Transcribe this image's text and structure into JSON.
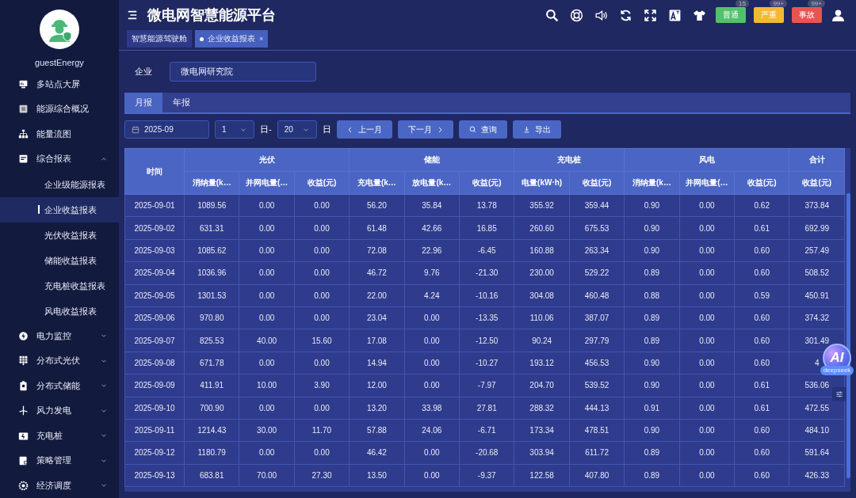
{
  "user": {
    "name": "guestEnergy"
  },
  "sidebar": {
    "items": [
      {
        "label": "多站点大屏"
      },
      {
        "label": "能源综合概况"
      },
      {
        "label": "能量流图"
      },
      {
        "label": "综合报表",
        "expanded": true,
        "children": [
          {
            "label": "企业级能源报表",
            "selected": false
          },
          {
            "label": "企业收益报表",
            "selected": true
          },
          {
            "label": "光伏收益报表",
            "selected": false
          },
          {
            "label": "储能收益报表",
            "selected": false
          },
          {
            "label": "充电桩收益报表",
            "selected": false
          },
          {
            "label": "风电收益报表",
            "selected": false
          }
        ]
      },
      {
        "label": "电力监控",
        "expanded": false
      },
      {
        "label": "分布式光伏",
        "expanded": false
      },
      {
        "label": "分布式储能",
        "expanded": false
      },
      {
        "label": "风力发电",
        "expanded": false
      },
      {
        "label": "充电桩",
        "expanded": false
      },
      {
        "label": "策略管理",
        "expanded": false
      },
      {
        "label": "经济调度",
        "expanded": false
      }
    ]
  },
  "header": {
    "title": "微电网智慧能源平台",
    "alerts": [
      {
        "label": "普通",
        "count": "15",
        "color": "#52c26a"
      },
      {
        "label": "严重",
        "count": "99+",
        "color": "#f4b832"
      },
      {
        "label": "事故",
        "count": "99+",
        "color": "#e9544f"
      }
    ]
  },
  "page_tabs": [
    {
      "label": "智慧能源驾驶舱",
      "selected": false
    },
    {
      "label": "企业收益报表",
      "selected": true,
      "close": "×"
    }
  ],
  "filter": {
    "label": "企业",
    "value": "微电网研究院"
  },
  "report_tabs": [
    {
      "label": "月报",
      "selected": true
    },
    {
      "label": "年报",
      "selected": false
    }
  ],
  "controls": {
    "month": "2025-09",
    "day_from": "1",
    "day_from_suffix": "日-",
    "day_to": "20",
    "day_to_suffix": "日",
    "prev": "上一月",
    "next": "下一月",
    "query": "查询",
    "export": "导出"
  },
  "table": {
    "groups": [
      {
        "label": "时间"
      },
      {
        "label": "光伏",
        "columns": [
          "消纳量(k…",
          "并网电量(…",
          "收益(元)"
        ]
      },
      {
        "label": "储能",
        "columns": [
          "充电量(k…",
          "放电量(k…",
          "收益(元)"
        ]
      },
      {
        "label": "充电桩",
        "columns": [
          "电量(kW·h)",
          "收益(元)"
        ]
      },
      {
        "label": "风电",
        "columns": [
          "消纳量(k…",
          "并网电量(…",
          "收益(元)"
        ]
      },
      {
        "label": "合计",
        "columns": [
          "收益(元)"
        ]
      }
    ],
    "rows": [
      [
        "2025-09-01",
        "1089.56",
        "0.00",
        "0.00",
        "56.20",
        "35.84",
        "13.78",
        "355.92",
        "359.44",
        "0.90",
        "0.00",
        "0.62",
        "373.84"
      ],
      [
        "2025-09-02",
        "631.31",
        "0.00",
        "0.00",
        "61.48",
        "42.66",
        "16.85",
        "260.60",
        "675.53",
        "0.90",
        "0.00",
        "0.61",
        "692.99"
      ],
      [
        "2025-09-03",
        "1085.62",
        "0.00",
        "0.00",
        "72.08",
        "22.96",
        "-6.45",
        "160.88",
        "263.34",
        "0.90",
        "0.00",
        "0.60",
        "257.49"
      ],
      [
        "2025-09-04",
        "1036.96",
        "0.00",
        "0.00",
        "46.72",
        "9.76",
        "-21.30",
        "230.00",
        "529.22",
        "0.89",
        "0.00",
        "0.60",
        "508.52"
      ],
      [
        "2025-09-05",
        "1301.53",
        "0.00",
        "0.00",
        "22.00",
        "4.24",
        "-10.16",
        "304.08",
        "460.48",
        "0.88",
        "0.00",
        "0.59",
        "450.91"
      ],
      [
        "2025-09-06",
        "970.80",
        "0.00",
        "0.00",
        "23.04",
        "0.00",
        "-13.35",
        "110.06",
        "387.07",
        "0.89",
        "0.00",
        "0.60",
        "374.32"
      ],
      [
        "2025-09-07",
        "825.53",
        "40.00",
        "15.60",
        "17.08",
        "0.00",
        "-12.50",
        "90.24",
        "297.79",
        "0.89",
        "0.00",
        "0.60",
        "301.49"
      ],
      [
        "2025-09-08",
        "671.78",
        "0.00",
        "0.00",
        "14.94",
        "0.00",
        "-10.27",
        "193.12",
        "456.53",
        "0.90",
        "0.00",
        "0.60",
        "4"
      ],
      [
        "2025-09-09",
        "411.91",
        "10.00",
        "3.90",
        "12.00",
        "0.00",
        "-7.97",
        "204.70",
        "539.52",
        "0.90",
        "0.00",
        "0.61",
        "536.06"
      ],
      [
        "2025-09-10",
        "700.90",
        "0.00",
        "0.00",
        "13.20",
        "33.98",
        "27.81",
        "288.32",
        "444.13",
        "0.91",
        "0.00",
        "0.61",
        "472.55"
      ],
      [
        "2025-09-11",
        "1214.43",
        "30.00",
        "11.70",
        "57.88",
        "24.06",
        "-6.71",
        "173.34",
        "478.51",
        "0.90",
        "0.00",
        "0.60",
        "484.10"
      ],
      [
        "2025-09-12",
        "1180.79",
        "0.00",
        "0.00",
        "46.42",
        "0.00",
        "-20.68",
        "303.94",
        "611.72",
        "0.89",
        "0.00",
        "0.60",
        "591.64"
      ],
      [
        "2025-09-13",
        "683.81",
        "70.00",
        "27.30",
        "13.50",
        "0.00",
        "-9.37",
        "122.58",
        "407.80",
        "0.89",
        "0.00",
        "0.60",
        "426.33"
      ]
    ]
  },
  "assistant": {
    "label": "AI",
    "caption": "deepseek"
  }
}
